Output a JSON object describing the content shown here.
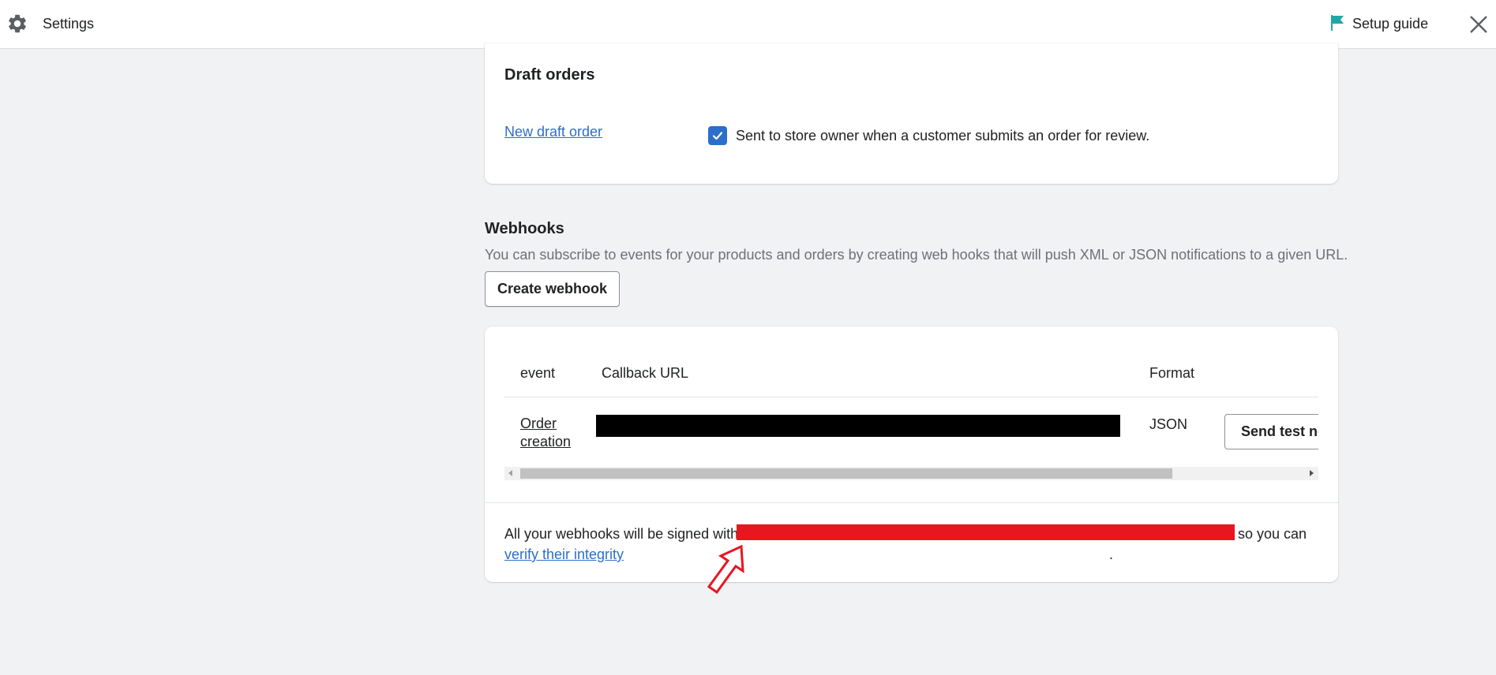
{
  "topbar": {
    "title": "Settings",
    "setup_guide": "Setup guide",
    "icons": {
      "settings": "gear-icon",
      "setup": "flag-icon",
      "close": "close-icon"
    },
    "flag_color": "#1fa7a7"
  },
  "draft_orders": {
    "title": "Draft orders",
    "link": "New draft order",
    "checkbox_checked": true,
    "checkbox_label": "Sent to store owner when a customer submits an order for review."
  },
  "webhooks": {
    "title": "Webhooks",
    "description": "You can subscribe to events for your products and orders by creating web hooks that will push XML or JSON notifications to a given URL.",
    "create_button": "Create webhook",
    "table": {
      "headers": [
        "event",
        "Callback URL",
        "Format"
      ],
      "rows": [
        {
          "event": "Order creation",
          "callback_url": "[redacted]",
          "format": "JSON",
          "action": "Send test notification"
        }
      ]
    },
    "signed_prefix": "All your webhooks will be signed with",
    "signed_suffix": "so you can",
    "verify_link": "verify their integrity",
    "verify_period": "."
  },
  "colors": {
    "accent": "#2c6ecb",
    "redaction_black": "#000000",
    "redaction_red": "#e8161f",
    "annotation_arrow": "#e8161f"
  }
}
